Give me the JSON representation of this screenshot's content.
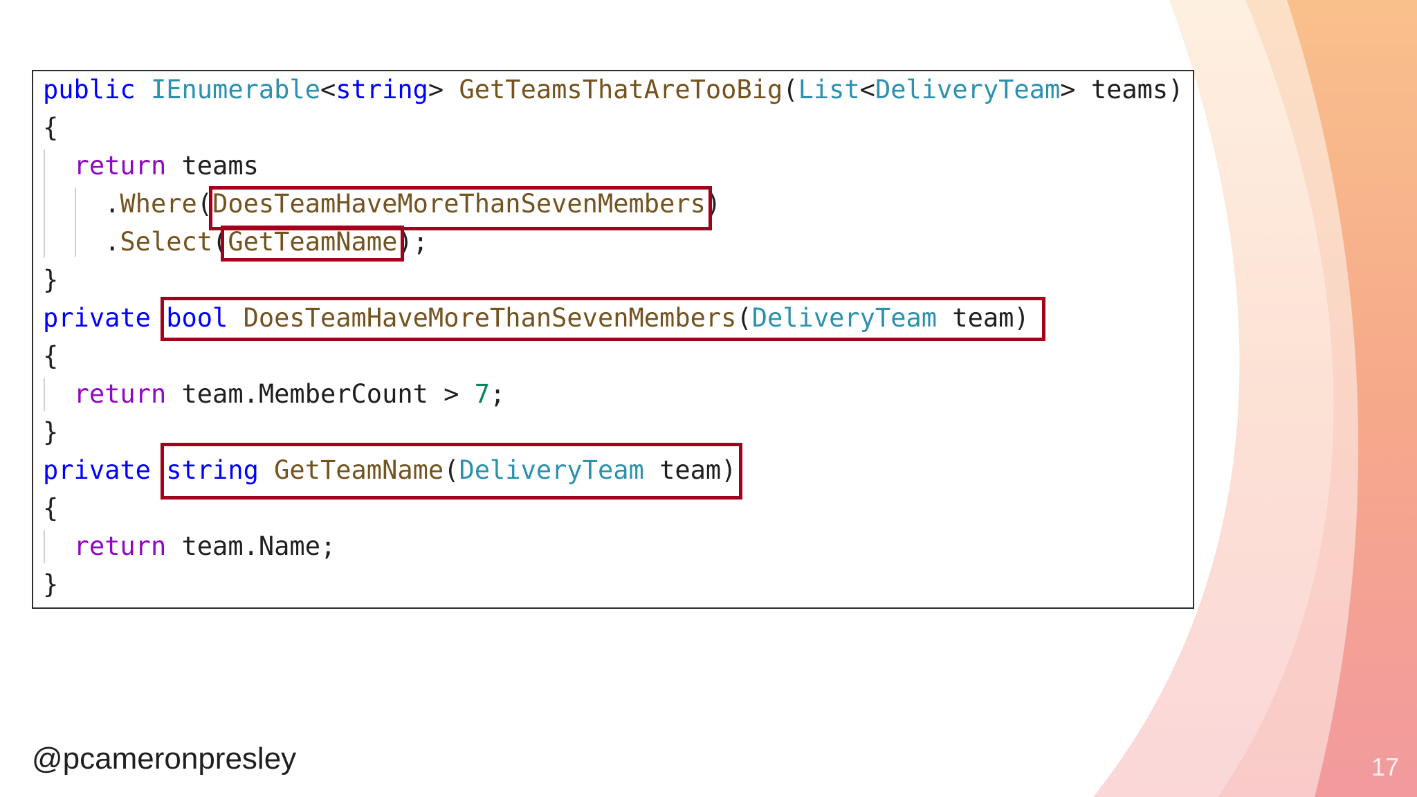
{
  "code": {
    "lines": [
      [
        {
          "t": "public",
          "c": "kw"
        },
        {
          "t": " ",
          "c": "plain"
        },
        {
          "t": "IEnumerable",
          "c": "typ"
        },
        {
          "t": "<",
          "c": "plain"
        },
        {
          "t": "string",
          "c": "kw"
        },
        {
          "t": "> ",
          "c": "plain"
        },
        {
          "t": "GetTeamsThatAreTooBig",
          "c": "mth"
        },
        {
          "t": "(",
          "c": "plain"
        },
        {
          "t": "List",
          "c": "typ"
        },
        {
          "t": "<",
          "c": "plain"
        },
        {
          "t": "DeliveryTeam",
          "c": "typ"
        },
        {
          "t": "> teams)",
          "c": "plain"
        }
      ],
      [
        {
          "t": "{",
          "c": "plain"
        }
      ],
      [
        {
          "t": "  ",
          "c": "plain"
        },
        {
          "t": "return",
          "c": "kw2"
        },
        {
          "t": " teams",
          "c": "plain"
        }
      ],
      [
        {
          "t": "    .",
          "c": "plain"
        },
        {
          "t": "Where",
          "c": "mth"
        },
        {
          "t": "(",
          "c": "plain"
        },
        {
          "t": "DoesTeamHaveMoreThanSevenMembers",
          "c": "mth"
        },
        {
          "t": ")",
          "c": "plain"
        }
      ],
      [
        {
          "t": "    .",
          "c": "plain"
        },
        {
          "t": "Select",
          "c": "mth"
        },
        {
          "t": "(",
          "c": "plain"
        },
        {
          "t": "GetTeamName",
          "c": "mth"
        },
        {
          "t": ");",
          "c": "plain"
        }
      ],
      [
        {
          "t": "}",
          "c": "plain"
        }
      ],
      [
        {
          "t": "private",
          "c": "kw"
        },
        {
          "t": " ",
          "c": "plain"
        },
        {
          "t": "bool",
          "c": "kw"
        },
        {
          "t": " ",
          "c": "plain"
        },
        {
          "t": "DoesTeamHaveMoreThanSevenMembers",
          "c": "mth"
        },
        {
          "t": "(",
          "c": "plain"
        },
        {
          "t": "DeliveryTeam",
          "c": "typ"
        },
        {
          "t": " team)",
          "c": "plain"
        }
      ],
      [
        {
          "t": "{",
          "c": "plain"
        }
      ],
      [
        {
          "t": "  ",
          "c": "plain"
        },
        {
          "t": "return",
          "c": "kw2"
        },
        {
          "t": " team.MemberCount > ",
          "c": "plain"
        },
        {
          "t": "7",
          "c": "num"
        },
        {
          "t": ";",
          "c": "plain"
        }
      ],
      [
        {
          "t": "}",
          "c": "plain"
        }
      ],
      [
        {
          "t": "private",
          "c": "kw"
        },
        {
          "t": " ",
          "c": "plain"
        },
        {
          "t": "string",
          "c": "kw"
        },
        {
          "t": " ",
          "c": "plain"
        },
        {
          "t": "GetTeamName",
          "c": "mth"
        },
        {
          "t": "(",
          "c": "plain"
        },
        {
          "t": "DeliveryTeam",
          "c": "typ"
        },
        {
          "t": " team)",
          "c": "plain"
        }
      ],
      [
        {
          "t": "{",
          "c": "plain"
        }
      ],
      [
        {
          "t": "  ",
          "c": "plain"
        },
        {
          "t": "return",
          "c": "kw2"
        },
        {
          "t": " team.Name;",
          "c": "plain"
        }
      ],
      [
        {
          "t": "}",
          "c": "plain"
        }
      ]
    ]
  },
  "footer": {
    "handle": "@pcameronpresley",
    "slide_number": "17"
  },
  "colors": {
    "keyword": "#0000ff",
    "control_keyword": "#8f08c4",
    "type": "#2b91af",
    "method": "#74531f",
    "number": "#098658",
    "highlight_border": "#a3001b",
    "gradient_peach": "#f9c38f",
    "gradient_pink": "#f4a0a4"
  }
}
